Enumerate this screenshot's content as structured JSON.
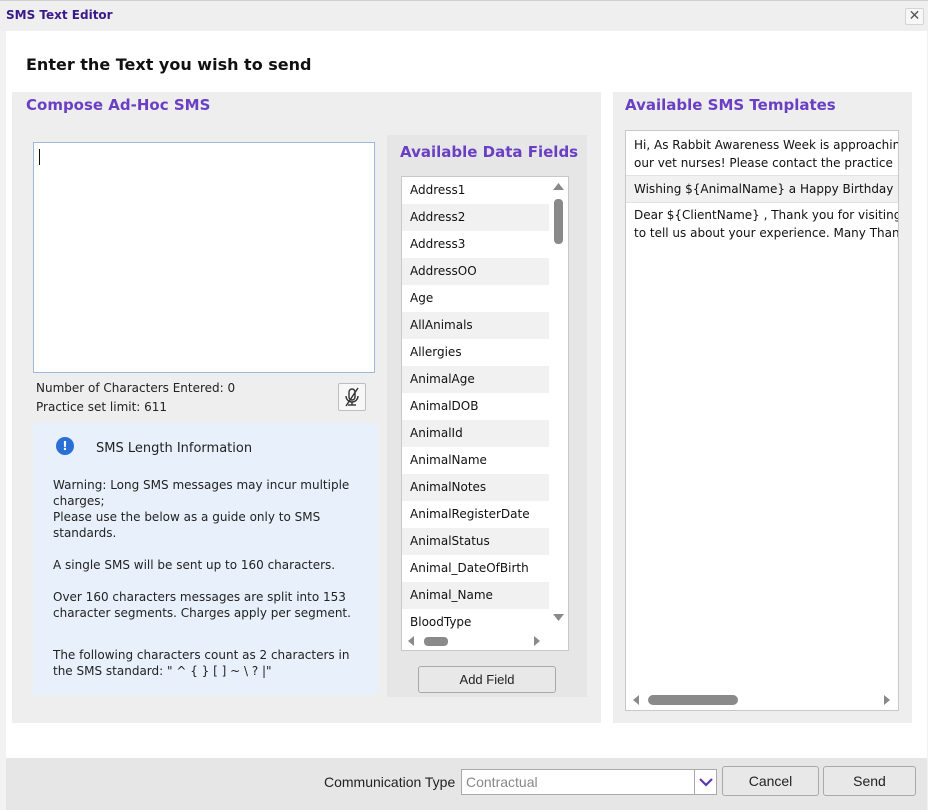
{
  "window": {
    "title": "SMS Text Editor",
    "close_label": "✕"
  },
  "heading": "Enter the Text you wish to send",
  "compose": {
    "title": "Compose Ad-Hoc SMS",
    "chars_entered": "Number of Characters Entered: 0",
    "limit": "Practice set limit: 611"
  },
  "info": {
    "icon": "!",
    "title": "SMS Length Information",
    "warning": "Warning: Long SMS messages may incur multiple charges;",
    "guide": "Please use the below as a guide only to SMS standards.",
    "single": "A single SMS will be sent up to 160 characters.",
    "split": "Over 160 characters messages are split into 153 character segments. Charges apply per segment.",
    "double": "The following characters count as 2 characters in the SMS standard: \" ^ { } [ ] ~ \\ ? |\""
  },
  "fields": {
    "title": "Available Data Fields",
    "items": [
      "Address1",
      "Address2",
      "Address3",
      "AddressOO",
      "Age",
      "AllAnimals",
      "Allergies",
      "AnimalAge",
      "AnimalDOB",
      "AnimalId",
      "AnimalName",
      "AnimalNotes",
      "AnimalRegisterDate",
      "AnimalStatus",
      "Animal_DateOfBirth",
      "Animal_Name",
      "BloodType"
    ],
    "add_button": "Add Field"
  },
  "templates": {
    "title": "Available SMS Templates",
    "items": [
      {
        "line1": "Hi, As Rabbit Awareness Week is approaching",
        "line2": "our vet nurses! Please contact the practice"
      },
      {
        "line1": "Wishing ${AnimalName} a Happy Birthday"
      },
      {
        "line1": "Dear ${ClientName} , Thank you for visiting",
        "line2": "to tell us about your experience. Many Thank"
      }
    ]
  },
  "footer": {
    "comm_type_label": "Communication Type",
    "comm_type_value": "Contractual",
    "cancel": "Cancel",
    "send": "Send"
  },
  "colors": {
    "accent": "#6a3fc4",
    "title": "#3a1a8a",
    "info_bg": "#e8f1fb",
    "info_icon": "#2a6fd6"
  },
  "icons": [
    "close-icon",
    "mic-off-icon",
    "info-icon",
    "scroll-up-icon",
    "scroll-down-icon",
    "scroll-left-icon",
    "scroll-right-icon",
    "chevron-down-icon"
  ]
}
